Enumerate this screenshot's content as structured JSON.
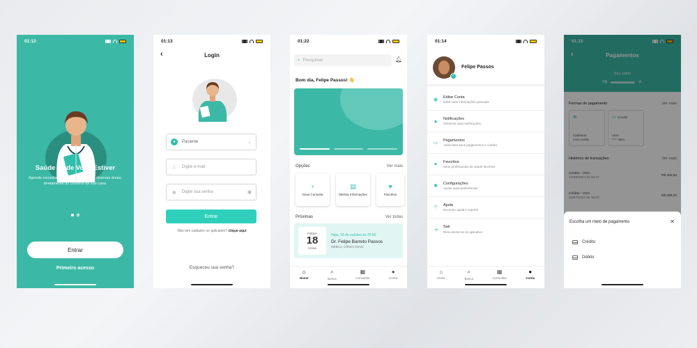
{
  "screens": {
    "onboarding": {
      "time": "01:13",
      "title": "Saúde Onde Você Estiver",
      "description": "Agende consultas com profissionais de diversas áreas, diretamente do conforto da sua casa.",
      "primary_button": "Entrar",
      "secondary_link": "Primeiro acesso"
    },
    "login": {
      "time": "01:13",
      "title": "Login",
      "profile_select": "Paciente",
      "email_placeholder": "Digite e-mail",
      "password_placeholder": "Digite sua senha",
      "submit": "Entrar",
      "signup_text": "Não tem cadastro no aplicativo?",
      "signup_link": "clique aqui",
      "forgot": "Esqueceu sua senha?"
    },
    "home": {
      "time": "01:22",
      "search_placeholder": "Pesquisar",
      "greeting": "Bom dia, Felipe Passos! 👋",
      "options_title": "Opções",
      "options_more": "Ver mais",
      "options": [
        {
          "label": "Nova Consulta"
        },
        {
          "label": "Minhas Informações"
        },
        {
          "label": "Favoritos"
        }
      ],
      "upcoming_title": "Próximas",
      "upcoming_more": "Ver todas",
      "appointment": {
        "prefix": "Faltam",
        "day": "18",
        "suffix": "Horas",
        "when": "Hoje, 18 de outubro às 20:00",
        "doctor": "Dr. Felipe Barreto Passos",
        "specialty": "Médico, Clínico Geral"
      },
      "tabs": [
        "Home",
        "Busca",
        "Consultas",
        "Conta"
      ]
    },
    "account": {
      "time": "01:14",
      "name": "Felipe Passos",
      "menu": [
        {
          "title": "Editar Conta",
          "subtitle": "Edite suas informações pessoais"
        },
        {
          "title": "Notificações",
          "subtitle": "Gerencie suas notificações"
        },
        {
          "title": "Pagamentos",
          "subtitle": "Administre seus pagamentos e cartões"
        },
        {
          "title": "Favoritos",
          "subtitle": "Seus profissionais de saúde favoritos"
        },
        {
          "title": "Configurações",
          "subtitle": "Ajuste suas preferências"
        },
        {
          "title": "Ajuda",
          "subtitle": "Encontre ajuda e suporte"
        },
        {
          "title": "Sair",
          "subtitle": "Desconecte-se do aplicativo"
        }
      ],
      "tabs": [
        "Home",
        "Busca",
        "Consultas",
        "Conta"
      ]
    },
    "payments": {
      "time": "01:15",
      "title": "Pagamentos",
      "balance_label": "Seu saldo",
      "currency": "R$",
      "methods_title": "Formas de pagamento",
      "methods_more": "Ver mais",
      "card_new_line1": "Cadastrar",
      "card_new_line2": "novo cartão",
      "card_credit_type": "Crédito",
      "card_credit_brand": "VISA",
      "card_credit_number": "**** 3661",
      "history_title": "Histórico de transações",
      "history_more": "Ver mais",
      "transactions": [
        {
          "label": "Crédito - VISA",
          "date": "17/09/2024 às 06:37",
          "amount": "R$ 300,00"
        },
        {
          "label": "Crédito - VISA",
          "date": "01/07/2024 às 18:20",
          "amount": "R$ 360,00"
        }
      ],
      "sheet_title": "Escolha um meio de pagamento",
      "sheet_options": [
        "Crédito",
        "Débito"
      ]
    }
  },
  "colors": {
    "primary": "#3cb8a6",
    "accent": "#2fd0bb",
    "light": "#e1f6f2"
  }
}
